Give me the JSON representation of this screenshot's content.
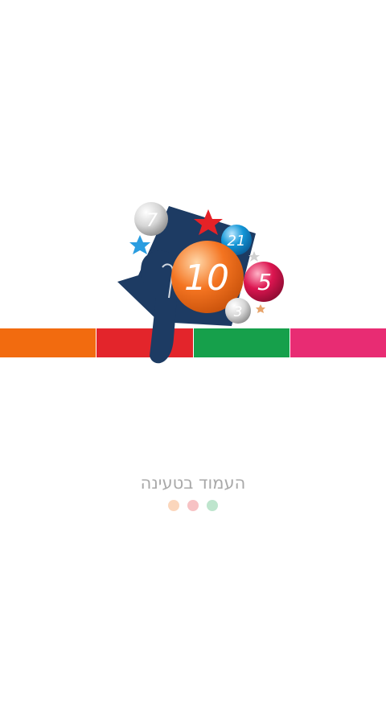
{
  "colors": {
    "background": "#ffffff",
    "stripes": [
      "#f26b0f",
      "#e3252b",
      "#16a04b",
      "#e82c73"
    ],
    "logo_navy": "#1d3b63",
    "ball_orange": "#f47421",
    "ball_red": "#dc1550",
    "ball_blue": "#1296d7",
    "star_red": "#e52227",
    "star_blue": "#2a9de0",
    "loading_dots": [
      "#f26b0f",
      "#e3252b",
      "#16a04b"
    ]
  },
  "logo": {
    "balls": [
      {
        "number": "7",
        "color": "silver"
      },
      {
        "number": "21",
        "color": "blue"
      },
      {
        "number": "10",
        "color": "orange"
      },
      {
        "number": "5",
        "color": "red"
      },
      {
        "number": "3",
        "color": "silver"
      }
    ]
  },
  "loading": {
    "text": "העמוד בטעינה",
    "dot_count": 3,
    "progress": 0
  }
}
